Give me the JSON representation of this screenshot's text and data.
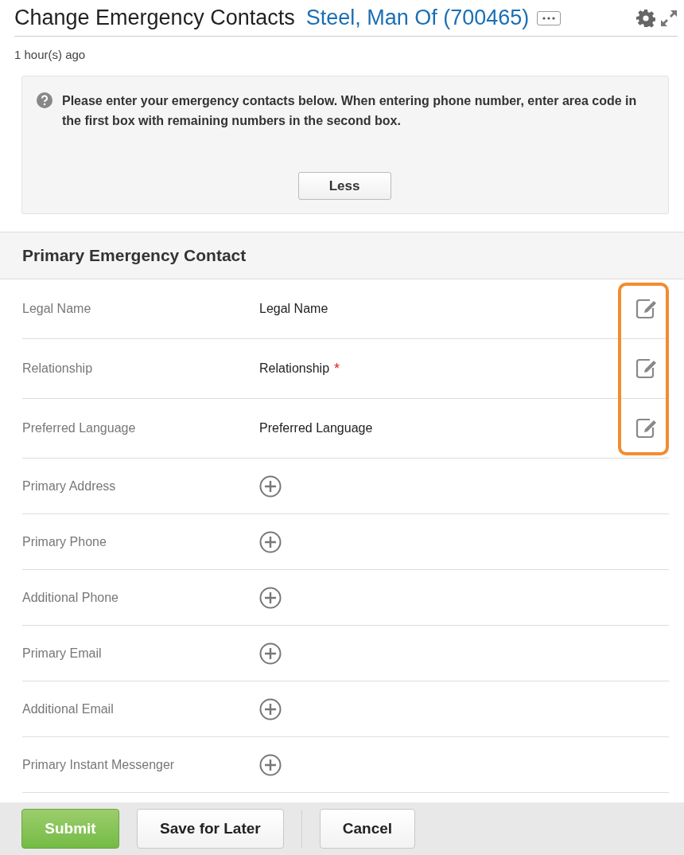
{
  "header": {
    "title": "Change Emergency Contacts",
    "subject": "Steel, Man Of (700465)",
    "timestamp": "1 hour(s) ago"
  },
  "info": {
    "message": "Please enter your emergency contacts below. When entering phone number, enter area code in the first box with remaining numbers in the second box.",
    "toggle_label": "Less"
  },
  "section": {
    "title": "Primary Emergency Contact",
    "edit_highlight": true,
    "required_marker": "*",
    "rows": [
      {
        "kind": "value",
        "label": "Legal Name",
        "value": "Legal Name",
        "required": false
      },
      {
        "kind": "value",
        "label": "Relationship",
        "value": "Relationship",
        "required": true
      },
      {
        "kind": "value",
        "label": "Preferred Language",
        "value": "Preferred Language",
        "required": false
      },
      {
        "kind": "add",
        "label": "Primary Address"
      },
      {
        "kind": "add",
        "label": "Primary Phone"
      },
      {
        "kind": "add",
        "label": "Additional Phone"
      },
      {
        "kind": "add",
        "label": "Primary Email"
      },
      {
        "kind": "add",
        "label": "Additional Email"
      },
      {
        "kind": "add",
        "label": "Primary Instant Messenger"
      }
    ]
  },
  "footer": {
    "buttons": [
      {
        "label": "Submit",
        "kind": "primary"
      },
      {
        "label": "Save for Later",
        "kind": "secondary"
      },
      {
        "kind": "separator"
      },
      {
        "label": "Cancel",
        "kind": "secondary"
      }
    ]
  }
}
